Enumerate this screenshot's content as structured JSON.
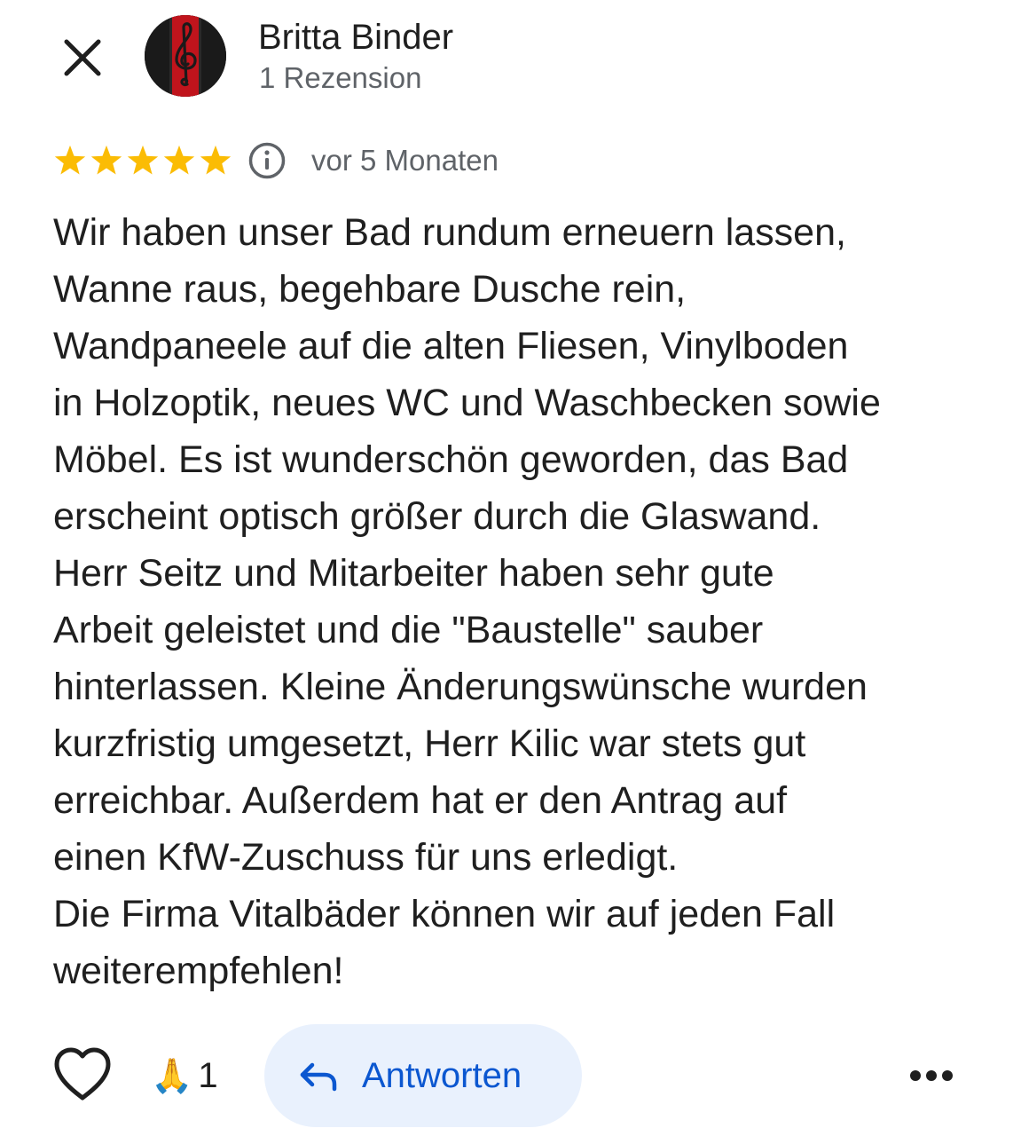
{
  "header": {
    "close_icon": "close-icon",
    "avatar_icon": "treble-clef-avatar",
    "reviewer_name": "Britta Binder",
    "review_count": "1 Rezension"
  },
  "review": {
    "rating": 5,
    "rating_max": 5,
    "star_color": "#fbbc04",
    "info_icon": "info-icon",
    "date": "vor 5 Monaten",
    "text": "Wir haben unser Bad rundum erneuern lassen,\nWanne raus, begehbare Dusche rein,\nWandpaneele auf die alten Fliesen, Vinylboden\nin Holzoptik, neues WC und Waschbecken sowie\nMöbel. Es ist wunderschön geworden, das Bad\nerscheint optisch größer durch die Glaswand.\nHerr Seitz und Mitarbeiter haben sehr gute\nArbeit geleistet und die \"Baustelle\" sauber\nhinterlassen. Kleine Änderungswünsche wurden\nkurzfristig umgesetzt, Herr Kilic war stets gut\nerreichbar. Außerdem hat er den Antrag auf\neinen KfW-Zuschuss für uns erledigt.\nDie Firma Vitalbäder können wir auf jeden Fall\nweiterempfehlen!"
  },
  "actions": {
    "like_icon": "heart-outline-icon",
    "reaction_emoji": "🙏",
    "reaction_count": "1",
    "reply_icon": "reply-arrow-icon",
    "reply_label": "Antworten",
    "reply_color": "#0b57d0",
    "reply_bg": "#e9f1fd",
    "more_icon": "more-horizontal-icon"
  }
}
